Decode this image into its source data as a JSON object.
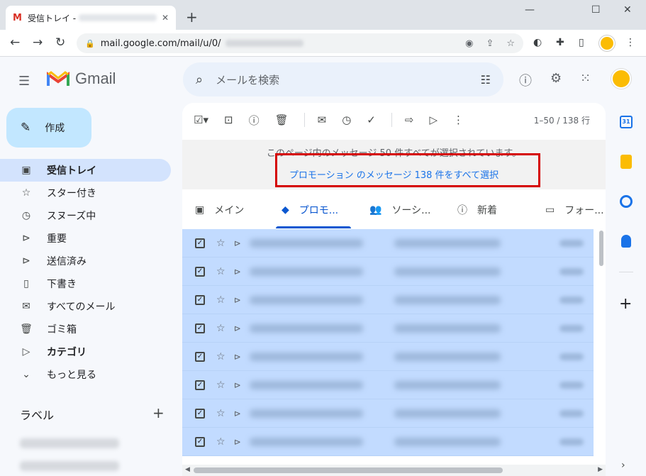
{
  "browser": {
    "tab_title": "受信トレイ -",
    "tab_favicon": "M",
    "tab_close": "✕",
    "new_tab": "+",
    "window_min": "—",
    "window_max": "☐",
    "window_close": "✕",
    "url": "mail.google.com/mail/u/0/",
    "nav_back": "←",
    "nav_forward": "→",
    "nav_reload": "↻"
  },
  "gmail": {
    "brand": "Gmail",
    "search_placeholder": "メールを検索",
    "compose_label": "作成"
  },
  "sidebar": {
    "items": [
      {
        "label": "受信トレイ",
        "icon": "inbox-icon",
        "glyph": "▣"
      },
      {
        "label": "スター付き",
        "icon": "star-icon",
        "glyph": "☆"
      },
      {
        "label": "スヌーズ中",
        "icon": "clock-icon",
        "glyph": "◷"
      },
      {
        "label": "重要",
        "icon": "important-icon",
        "glyph": "⊳"
      },
      {
        "label": "送信済み",
        "icon": "send-icon",
        "glyph": "⊳"
      },
      {
        "label": "下書き",
        "icon": "draft-icon",
        "glyph": "▯"
      },
      {
        "label": "すべてのメール",
        "icon": "all-mail-icon",
        "glyph": "✉"
      },
      {
        "label": "ゴミ箱",
        "icon": "trash-icon",
        "glyph": "🗑"
      },
      {
        "label": "カテゴリ",
        "icon": "label-icon",
        "glyph": "▷"
      },
      {
        "label": "もっと見る",
        "icon": "chevron-down-icon",
        "glyph": "⌄"
      }
    ],
    "labels_header": "ラベル",
    "labels_add": "+"
  },
  "toolbar": {
    "pager": "1–50 / 138 行"
  },
  "selection": {
    "message": "このページ内のメッセージ 50 件すべてが選択されています。",
    "select_all_link": "プロモーション のメッセージ 138 件をすべて選択"
  },
  "categories": [
    {
      "label": "メイン",
      "glyph": "▣"
    },
    {
      "label": "プロモ...",
      "glyph": "◆"
    },
    {
      "label": "ソーシ...",
      "glyph": "👥"
    },
    {
      "label": "新着",
      "glyph": "ⓘ"
    },
    {
      "label": "フォー...",
      "glyph": "▭"
    }
  ],
  "rail": {
    "calendar_day": "31",
    "add": "+",
    "expand": "›"
  }
}
